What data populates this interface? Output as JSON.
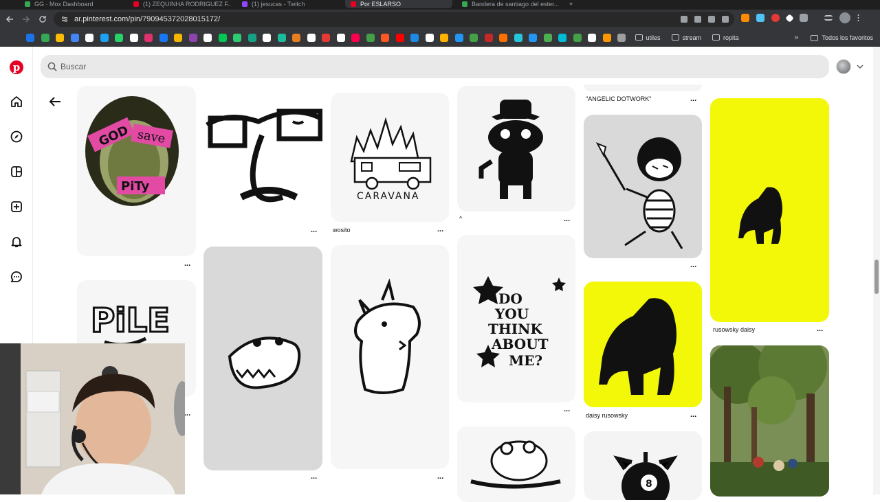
{
  "browser": {
    "tabs": [
      {
        "label": "GG · Mox Dashboard",
        "active": false,
        "color": "#34a853"
      },
      {
        "label": "(1) ZEQUINHA RODRIGUEZ F...",
        "active": false,
        "color": "#e60023"
      },
      {
        "label": "(1) jesucas - Twitch",
        "active": false,
        "color": "#9146ff"
      },
      {
        "label": "Por ESLARSO",
        "active": true,
        "color": "#e60023"
      },
      {
        "label": "Bandera de santiago del ester...",
        "active": false,
        "color": "#34a853"
      }
    ],
    "url": "ar.pinterest.com/pin/790945372028015172/",
    "bookmark_folders": [
      "utiles",
      "stream",
      "ropita"
    ],
    "all_bookmarks_label": "Todos los favoritos",
    "bookmark_icon_colors": [
      "#1a73e8",
      "#34a853",
      "#fbbc04",
      "#4285f4",
      "#ffffff",
      "#1da1f2",
      "#25d366",
      "#ffffff",
      "#e1306c",
      "#1877f2",
      "#f4b400",
      "#8e44ad",
      "#ffffff",
      "#00c853",
      "#2ecc71",
      "#16a085",
      "#ffffff",
      "#1abc9c",
      "#e67e22",
      "#ffffff",
      "#e53935",
      "#ffffff",
      "#ff0050",
      "#43a047",
      "#ff5722",
      "#ff0000",
      "#1e88e5",
      "#ffffff",
      "#ffb300",
      "#2196f3",
      "#43a047",
      "#c62828",
      "#ff6f00",
      "#26c6da",
      "#2196f3",
      "#4caf50",
      "#00bcd4",
      "#43a047",
      "#ffffff",
      "#ff9800",
      "#9e9e9e"
    ],
    "extension_colors": [
      "#ff8c00",
      "#4fc3f7",
      "#e53935",
      "#ffffff",
      "#9aa0a6"
    ]
  },
  "app": {
    "search_placeholder": "Buscar",
    "sidebar_icons": [
      "home-icon",
      "explore-icon",
      "create-board-icon",
      "create-icon",
      "notifications-icon",
      "messages-icon"
    ]
  },
  "pins": [
    {
      "id": "god-save-pity",
      "caption": "",
      "text_art": [
        "GOD",
        "save",
        "PiTy"
      ],
      "bg": "#f6f6f6"
    },
    {
      "id": "face-doodle",
      "caption": "",
      "bg": "#ffffff"
    },
    {
      "id": "caravana",
      "caption": "wosito",
      "text_art": [
        "CARAVANA"
      ],
      "bg": "#f6f6f6"
    },
    {
      "id": "cowboy-frog",
      "caption": "^",
      "bg": "#f4f4f4"
    },
    {
      "id": "angelic-dotwork",
      "caption": "\"ANGELIC DOTWORK\"",
      "bg": "#f4f4f4"
    },
    {
      "id": "devil-skeleton",
      "caption": "",
      "bg": "#d9d9d9"
    },
    {
      "id": "yellow-gorilla-tall",
      "caption": "rusowsky daisy",
      "bg": "#f3f708"
    },
    {
      "id": "pile-lettering",
      "caption": "",
      "text_art": [
        "PiLE"
      ],
      "bg": "#f6f6f6"
    },
    {
      "id": "croc-head",
      "caption": "",
      "bg": "#d9d9d9"
    },
    {
      "id": "rhino-doodle",
      "caption": "",
      "bg": "#f6f6f6"
    },
    {
      "id": "think-about-me",
      "caption": "",
      "text_art": [
        "DO",
        "YOU",
        "THINK",
        "ABOUT",
        "ME?"
      ],
      "bg": "#f6f6f6"
    },
    {
      "id": "yellow-gorilla",
      "caption": "daisy rusowsky",
      "bg": "#f3f708"
    },
    {
      "id": "frog-drawing",
      "caption": "",
      "bg": "#f6f6f6"
    },
    {
      "id": "eight-ball",
      "caption": "",
      "bg": "#f4f4f4"
    },
    {
      "id": "forest-painting",
      "caption": "",
      "bg": "#5f7a3a"
    }
  ],
  "more_options_label": "..."
}
